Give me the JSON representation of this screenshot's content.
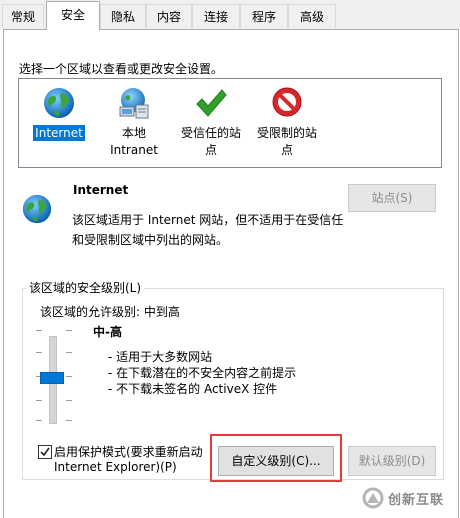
{
  "tabs": [
    {
      "label": "常规",
      "active": false
    },
    {
      "label": "安全",
      "active": true
    },
    {
      "label": "隐私",
      "active": false
    },
    {
      "label": "内容",
      "active": false
    },
    {
      "label": "连接",
      "active": false
    },
    {
      "label": "程序",
      "active": false
    },
    {
      "label": "高级",
      "active": false
    }
  ],
  "instruction": "选择一个区域以查看或更改安全设置。",
  "zones": [
    {
      "line1": "Internet",
      "line2": "",
      "icon": "globe-icon",
      "selected": true
    },
    {
      "line1": "本地",
      "line2": "Intranet",
      "icon": "intranet-icon",
      "selected": false
    },
    {
      "line1": "受信任的站",
      "line2": "点",
      "icon": "checkmark-icon",
      "selected": false
    },
    {
      "line1": "受限制的站",
      "line2": "点",
      "icon": "restricted-icon",
      "selected": false
    }
  ],
  "selected_zone": {
    "title": "Internet",
    "desc_line1": "该区域适用于 Internet 网站，但不适用于在受信任",
    "desc_line2": "和受限制区域中列出的网站。"
  },
  "sites_button": "站点(S)",
  "security_level": {
    "group_title": "该区域的安全级别(L)",
    "allowed_levels": "该区域的允许级别: 中到高",
    "level_name": "中-高",
    "bullets": [
      "- 适用于大多数网站",
      "- 在下载潜在的不安全内容之前提示",
      "- 不下载未签名的 ActiveX 控件"
    ],
    "slider_level": "中-高"
  },
  "protected_mode": {
    "line1": "启用保护模式(要求重新启动",
    "line2": "Internet Explorer)(P)",
    "checked": true
  },
  "custom_level_button": "自定义级别(C)...",
  "default_level_button": "默认级别(D)",
  "watermark": {
    "line1": "创新互联"
  },
  "colors": {
    "accent": "#0078d7",
    "highlight_border": "#e53a3a",
    "check_green": "#2fa12a",
    "restricted_red": "#d9262b"
  }
}
